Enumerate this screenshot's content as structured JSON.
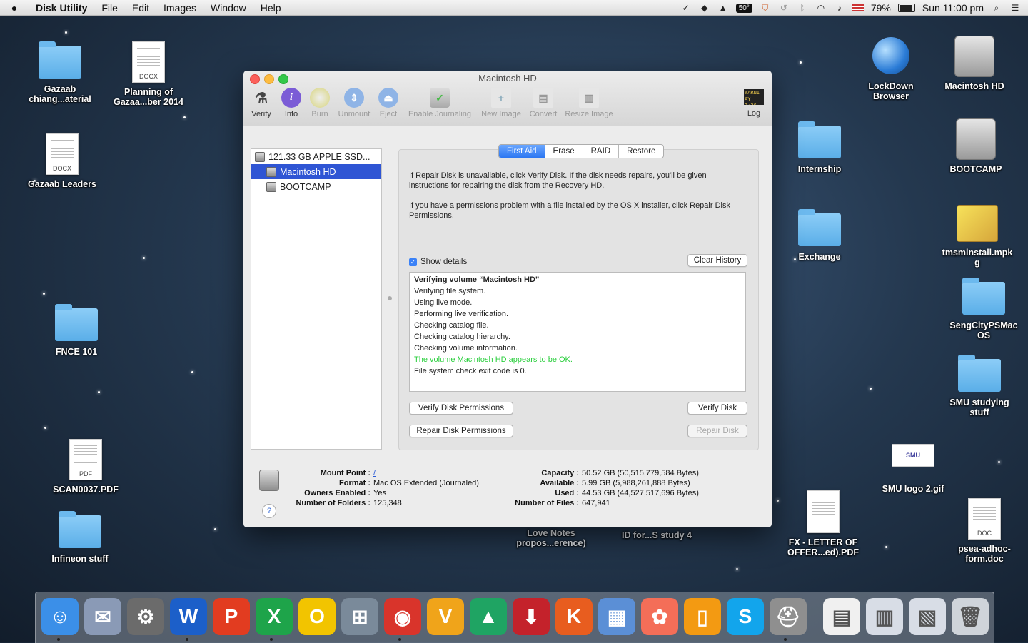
{
  "menubar": {
    "app_name": "Disk Utility",
    "items": [
      "File",
      "Edit",
      "Images",
      "Window",
      "Help"
    ],
    "temperature": "50°",
    "battery": "79%",
    "clock": "Sun 11:00 pm"
  },
  "desktop": {
    "icons": [
      {
        "label": "Gazaab\nchiang...aterial",
        "kind": "folder"
      },
      {
        "label": "Planning of\nGazaa...ber 2014",
        "kind": "docx",
        "type": "DOCX"
      },
      {
        "label": "Gazaab Leaders",
        "kind": "docx",
        "type": "DOCX"
      },
      {
        "label": "FNCE 101",
        "kind": "folder"
      },
      {
        "label": "SCAN0037.PDF",
        "kind": "pdf",
        "type": "PDF"
      },
      {
        "label": "Infineon stuff",
        "kind": "folder"
      },
      {
        "label": "LockDown\nBrowser",
        "kind": "app"
      },
      {
        "label": "Macintosh HD",
        "kind": "hdd"
      },
      {
        "label": "Internship",
        "kind": "folder"
      },
      {
        "label": "BOOTCAMP",
        "kind": "hdd"
      },
      {
        "label": "Exchange",
        "kind": "folder"
      },
      {
        "label": "tmsminstall.mpk\ng",
        "kind": "package"
      },
      {
        "label": "SengCityPSMac\nOS",
        "kind": "folder"
      },
      {
        "label": "SMU studying\nstuff",
        "kind": "folder"
      },
      {
        "label": "SMU logo 2.gif",
        "kind": "image",
        "logo_text": "SMU"
      },
      {
        "label": "FX - LETTER OF\nOFFER...ed).PDF",
        "kind": "pdf",
        "type": ""
      },
      {
        "label": "psea-adhoc-\nform.doc",
        "kind": "doc",
        "type": "DOC"
      },
      {
        "label": "Love Notes\npropos...erence)",
        "kind": "hidden"
      },
      {
        "label": "ID for...S study 4",
        "kind": "hidden"
      }
    ]
  },
  "window": {
    "title": "Macintosh HD",
    "toolbar": [
      {
        "label": "Verify",
        "icon": "microscope-icon",
        "enabled": true
      },
      {
        "label": "Info",
        "icon": "info-icon",
        "enabled": true
      },
      {
        "label": "Burn",
        "icon": "burn-icon",
        "enabled": false
      },
      {
        "label": "Unmount",
        "icon": "unmount-icon",
        "enabled": false
      },
      {
        "label": "Eject",
        "icon": "eject-icon",
        "enabled": false
      },
      {
        "label": "Enable Journaling",
        "icon": "journaling-icon",
        "enabled": false
      },
      {
        "label": "New Image",
        "icon": "new-image-icon",
        "enabled": false
      },
      {
        "label": "Convert",
        "icon": "convert-icon",
        "enabled": false
      },
      {
        "label": "Resize Image",
        "icon": "resize-image-icon",
        "enabled": false
      },
      {
        "label": "Log",
        "icon": "log-icon",
        "enabled": true,
        "screen_text": "WARNI\nAY 7:36"
      }
    ],
    "sidebar": {
      "disk": "121.33 GB APPLE SSD...",
      "volumes": [
        "Macintosh HD",
        "BOOTCAMP"
      ],
      "selected": "Macintosh HD"
    },
    "tabs": [
      "First Aid",
      "Erase",
      "RAID",
      "Restore"
    ],
    "active_tab": "First Aid",
    "help_text_1": "If Repair Disk is unavailable, click Verify Disk. If the disk needs repairs, you'll be given instructions for repairing the disk from the Recovery HD.",
    "help_text_2": "If you have a permissions problem with a file installed by the OS X installer, click Repair Disk Permissions.",
    "show_details_label": "Show details",
    "show_details_checked": true,
    "clear_history_label": "Clear History",
    "log_lines": [
      {
        "text": "Verifying volume “Macintosh HD”",
        "style": "bold"
      },
      {
        "text": "Verifying file system.",
        "style": ""
      },
      {
        "text": "Using live mode.",
        "style": ""
      },
      {
        "text": "Performing live verification.",
        "style": ""
      },
      {
        "text": "Checking catalog file.",
        "style": ""
      },
      {
        "text": "Checking catalog hierarchy.",
        "style": ""
      },
      {
        "text": "Checking volume information.",
        "style": ""
      },
      {
        "text": "The volume Macintosh HD appears to be OK.",
        "style": "ok"
      },
      {
        "text": "File system check exit code is 0.",
        "style": ""
      }
    ],
    "buttons": {
      "verify_permissions": "Verify Disk Permissions",
      "verify_disk": "Verify Disk",
      "repair_permissions": "Repair Disk Permissions",
      "repair_disk": "Repair Disk"
    },
    "info": {
      "mount_point_label": "Mount Point :",
      "mount_point": "/",
      "format_label": "Format :",
      "format": "Mac OS Extended (Journaled)",
      "owners_label": "Owners Enabled :",
      "owners": "Yes",
      "folders_label": "Number of Folders :",
      "folders": "125,348",
      "capacity_label": "Capacity :",
      "capacity": "50.52 GB (50,515,779,584 Bytes)",
      "available_label": "Available :",
      "available": "5.99 GB (5,988,261,888 Bytes)",
      "used_label": "Used :",
      "used": "44.53 GB (44,527,517,696 Bytes)",
      "files_label": "Number of Files :",
      "files": "647,941",
      "help": "?"
    }
  },
  "dock": {
    "apps": [
      {
        "name": "finder-icon",
        "glyph": "☺",
        "color": "#3b8fe8"
      },
      {
        "name": "mail-icon",
        "glyph": "✉",
        "color": "#8a9ab6"
      },
      {
        "name": "system-preferences-icon",
        "glyph": "⚙",
        "color": "#6b6b6b"
      },
      {
        "name": "word-icon",
        "glyph": "W",
        "color": "#1c5fc9"
      },
      {
        "name": "powerpoint-icon",
        "glyph": "P",
        "color": "#e23c20"
      },
      {
        "name": "excel-icon",
        "glyph": "X",
        "color": "#1ea44a"
      },
      {
        "name": "outlook-icon",
        "glyph": "O",
        "color": "#f2c400"
      },
      {
        "name": "remote-desktop-icon",
        "glyph": "⊞",
        "color": "#7a8a9a"
      },
      {
        "name": "chrome-icon",
        "glyph": "◉",
        "color": "#d9342b"
      },
      {
        "name": "vlc-like-icon",
        "glyph": "V",
        "color": "#f0a41a"
      },
      {
        "name": "google-drive-icon",
        "glyph": "▲",
        "color": "#1fa463"
      },
      {
        "name": "downloader-icon",
        "glyph": "⬇",
        "color": "#c4222b"
      },
      {
        "name": "keynote-icon",
        "glyph": "K",
        "color": "#e85d1f"
      },
      {
        "name": "preview-icon",
        "glyph": "▦",
        "color": "#5b8fd6"
      },
      {
        "name": "photos-icon",
        "glyph": "✿",
        "color": "#f46e58"
      },
      {
        "name": "ibooks-icon",
        "glyph": "▯",
        "color": "#f39a12"
      },
      {
        "name": "skype-icon",
        "glyph": "S",
        "color": "#12a5ec"
      },
      {
        "name": "disk-utility-icon",
        "glyph": "⛑",
        "color": "#8f8f8f"
      }
    ],
    "right_items": [
      {
        "name": "document-stack-icon",
        "glyph": "▤",
        "color": "#f0f0f0"
      },
      {
        "name": "downloads-stack-icon",
        "glyph": "▥",
        "color": "#d8dde6"
      },
      {
        "name": "screenshot-stack-icon",
        "glyph": "▧",
        "color": "#d8dde6"
      },
      {
        "name": "trash-icon",
        "glyph": "🗑",
        "color": "#cfd4da"
      }
    ]
  }
}
